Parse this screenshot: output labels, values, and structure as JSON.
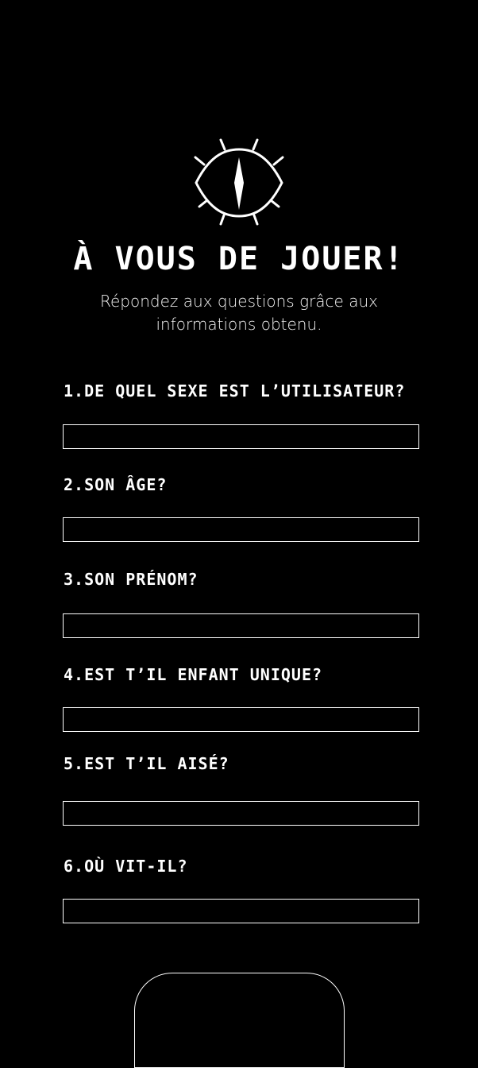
{
  "header": {
    "logo_icon": "eye-compass-icon",
    "title": "À VOUS DE JOUER!",
    "subtitle": "Répondez aux questions grâce aux informations obtenu."
  },
  "questions": [
    {
      "label": "1.DE QUEL SEXE EST L’UTILISATEUR?",
      "value": "",
      "placeholder": ""
    },
    {
      "label": "2.SON ÂGE?",
      "value": "",
      "placeholder": ""
    },
    {
      "label": "3.SON PRÉNOM?",
      "value": "",
      "placeholder": ""
    },
    {
      "label": "4.EST T’IL ENFANT UNIQUE?",
      "value": "",
      "placeholder": ""
    },
    {
      "label": "5.EST T’IL AISÉ?",
      "value": "",
      "placeholder": ""
    },
    {
      "label": "6.OÙ VIT-IL?",
      "value": "",
      "placeholder": ""
    }
  ],
  "colors": {
    "background": "#000000",
    "foreground": "#ffffff"
  }
}
